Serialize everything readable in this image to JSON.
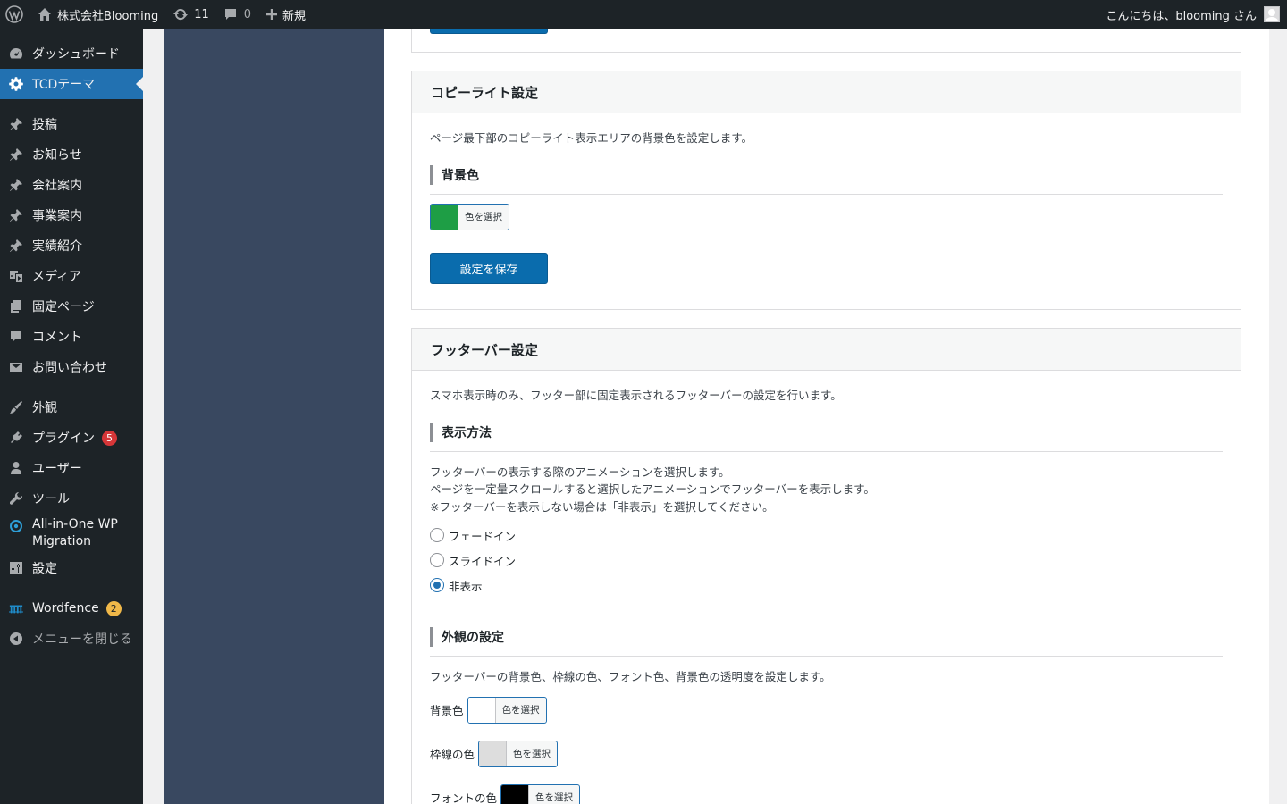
{
  "adminbar": {
    "site_name": "株式会社Blooming",
    "updates_count": "11",
    "comments_count": "0",
    "new_label": "新規",
    "greeting": "こんにちは、blooming さん"
  },
  "sidebar": {
    "items": [
      {
        "label": "ダッシュボード",
        "icon": "dashboard-icon"
      },
      {
        "label": "TCDテーマ",
        "icon": "gear-icon"
      },
      {
        "label": "投稿",
        "icon": "pin-icon"
      },
      {
        "label": "お知らせ",
        "icon": "pin-icon"
      },
      {
        "label": "会社案内",
        "icon": "pin-icon"
      },
      {
        "label": "事業案内",
        "icon": "pin-icon"
      },
      {
        "label": "実績紹介",
        "icon": "pin-icon"
      },
      {
        "label": "メディア",
        "icon": "media-icon"
      },
      {
        "label": "固定ページ",
        "icon": "page-icon"
      },
      {
        "label": "コメント",
        "icon": "comment-icon"
      },
      {
        "label": "お問い合わせ",
        "icon": "mail-icon"
      },
      {
        "label": "外観",
        "icon": "brush-icon"
      },
      {
        "label": "プラグイン",
        "icon": "plugin-icon",
        "badge": "5"
      },
      {
        "label": "ユーザー",
        "icon": "user-icon"
      },
      {
        "label": "ツール",
        "icon": "wrench-icon"
      },
      {
        "label": "All-in-One WP Migration",
        "line1": "All-in-One WP",
        "line2": "Migration",
        "icon": "migration-icon"
      },
      {
        "label": "設定",
        "icon": "settings-icon"
      },
      {
        "label": "Wordfence",
        "icon": "wordfence-icon",
        "badge": "2"
      },
      {
        "label": "メニューを閉じる",
        "icon": "collapse-icon"
      }
    ]
  },
  "copyright_panel": {
    "title": "コピーライト設定",
    "description": "ページ最下部のコピーライト表示エリアの背景色を設定します。",
    "bg_heading": "背景色",
    "bg_color": "#1e9e45",
    "color_picker_label": "色を選択",
    "save_label": "設定を保存"
  },
  "footerbar_panel": {
    "title": "フッターバー設定",
    "description": "スマホ表示時のみ、フッター部に固定表示されるフッターバーの設定を行います。",
    "display_heading": "表示方法",
    "display_desc_1": "フッターバーの表示する際のアニメーションを選択します。",
    "display_desc_2": "ページを一定量スクロールすると選択したアニメーションでフッターバーを表示します。",
    "display_desc_3": "※フッターバーを表示しない場合は「非表示」を選択してください。",
    "options": [
      {
        "label": "フェードイン",
        "checked": false
      },
      {
        "label": "スライドイン",
        "checked": false
      },
      {
        "label": "非表示",
        "checked": true
      }
    ],
    "appearance_heading": "外観の設定",
    "appearance_desc": "フッターバーの背景色、枠線の色、フォント色、背景色の透明度を設定します。",
    "bg_label": "背景色",
    "bg_color": "#ffffff",
    "border_label": "枠線の色",
    "border_color": "#dddddd",
    "font_label": "フォントの色",
    "font_color": "#000000",
    "color_picker_label": "色を選択"
  }
}
